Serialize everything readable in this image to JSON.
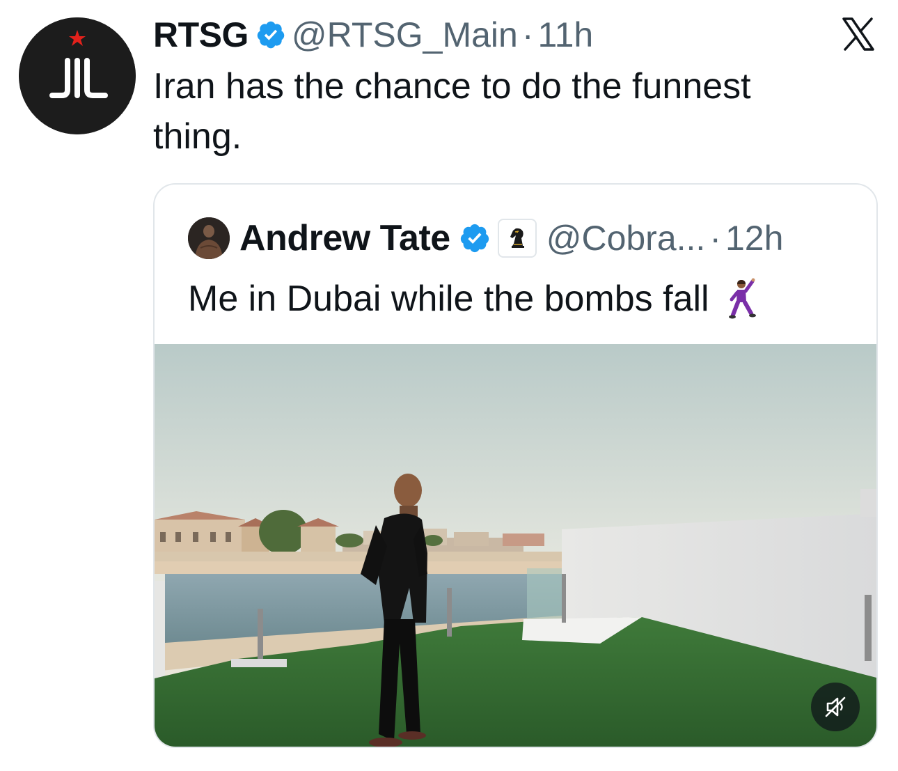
{
  "tweet": {
    "author": {
      "name": "RTSG",
      "handle": "@RTSG_Main",
      "verified": true
    },
    "separator": "·",
    "time": "11h",
    "text": "Iran has the chance to do the funnest thing."
  },
  "quoted_tweet": {
    "author": {
      "name": "Andrew Tate",
      "handle": "@Cobra...",
      "verified": true,
      "affiliation_icon": "chess-knight-icon"
    },
    "separator": "·",
    "time": "12h",
    "text": "Me in Dubai while the bombs fall",
    "emoji": "man-dancing-emoji",
    "media": {
      "type": "video",
      "muted": true,
      "control_icon": "muted-speaker-icon"
    }
  },
  "platform_icon": "x-logo-icon",
  "colors": {
    "verified": "#1d9bf0",
    "secondary_text": "#536471",
    "primary_text": "#0f1419",
    "border": "#e1e6ea"
  }
}
